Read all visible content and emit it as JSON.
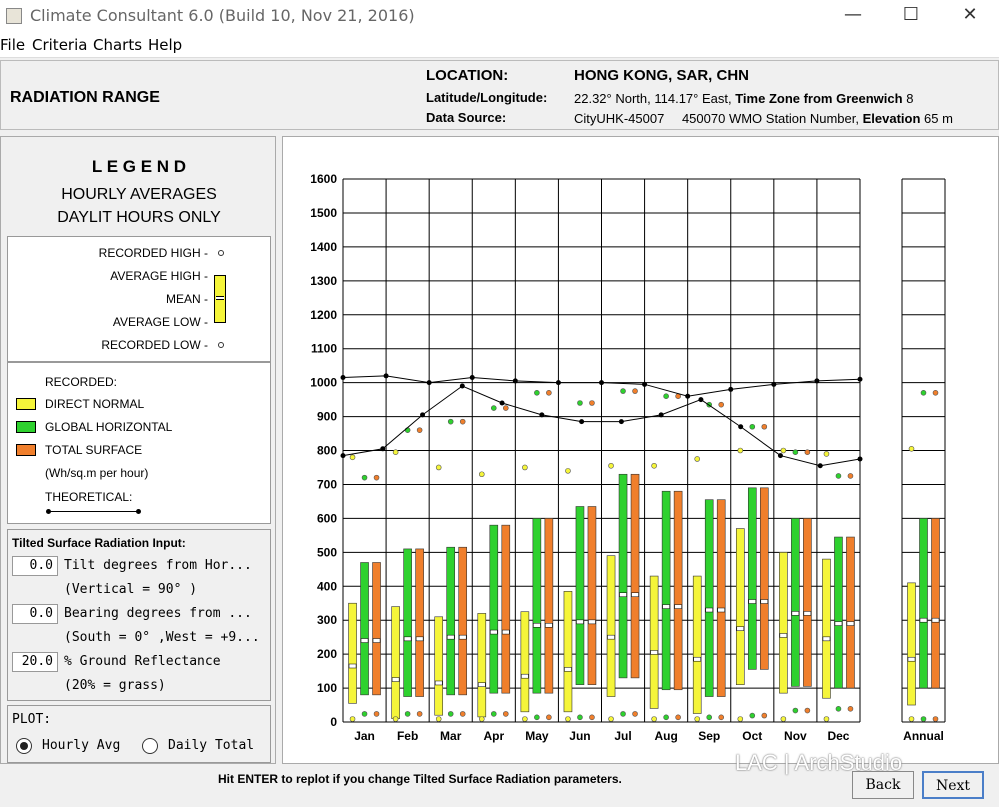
{
  "window": {
    "title": "Climate Consultant 6.0 (Build 10, Nov 21, 2016)",
    "minimize": "—",
    "maximize": "☐",
    "close": "✕"
  },
  "menu": [
    "File",
    "Criteria",
    "Charts",
    "Help"
  ],
  "header": {
    "page_title": "RADIATION RANGE",
    "location_label": "LOCATION:",
    "location_value": "HONG KONG, SAR, CHN",
    "latlon_label": "Latitude/Longitude:",
    "latlon_value": "22.32° North, 114.17° East,",
    "tz_label": "Time Zone from Greenwich",
    "tz_value": "8",
    "source_label": "Data Source:",
    "source_value": "CityUHK-45007",
    "wmo_value": "450070 WMO Station Number,",
    "elev_label": "Elevation",
    "elev_value": "65 m"
  },
  "legend": {
    "title": "L E G E N D",
    "subtitle1": "HOURLY AVERAGES",
    "subtitle2": "DAYLIT HOURS ONLY",
    "recorded_high": "RECORDED HIGH -",
    "average_high": "AVERAGE HIGH -",
    "mean": "MEAN -",
    "average_low": "AVERAGE LOW -",
    "recorded_low": "RECORDED LOW -",
    "recorded": "RECORDED:",
    "direct_normal": "DIRECT NORMAL",
    "global_horizontal": "GLOBAL HORIZONTAL",
    "total_surface": "TOTAL SURFACE",
    "units": "(Wh/sq.m per hour)",
    "theoretical": "THEORETICAL:"
  },
  "tilted": {
    "title": "Tilted Surface Radiation Input:",
    "tilt_value": "0.0",
    "tilt_label": "Tilt degrees from Hor...",
    "tilt_note": "(Vertical = 90° )",
    "bearing_value": "0.0",
    "bearing_label": "Bearing degrees from ...",
    "bearing_note": "(South = 0° ,West = +9...",
    "ground_value": "20.0",
    "ground_label": "% Ground Reflectance",
    "ground_note": "(20% = grass)"
  },
  "plot": {
    "title": "PLOT:",
    "hourly": "Hourly Avg",
    "daily": "Daily Total",
    "selected": "hourly"
  },
  "footer": {
    "message": "Hit ENTER to replot if you change Tilted Surface Radiation parameters.",
    "back": "Back",
    "next": "Next"
  },
  "watermark": "LAC | ArchStudio",
  "colors": {
    "direct_normal": "#f5f53a",
    "global_horizontal": "#2ed12e",
    "total_surface": "#f07f2c",
    "mean": "#ffffff"
  },
  "chart_data": {
    "type": "bar",
    "ylim": [
      0,
      1600
    ],
    "yticks": [
      0,
      100,
      200,
      300,
      400,
      500,
      600,
      700,
      800,
      900,
      1000,
      1100,
      1200,
      1300,
      1400,
      1500,
      1600
    ],
    "categories": [
      "Jan",
      "Feb",
      "Mar",
      "Apr",
      "May",
      "Jun",
      "Jul",
      "Aug",
      "Sep",
      "Oct",
      "Nov",
      "Dec"
    ],
    "annual_label": "Annual",
    "series": [
      {
        "name": "DIRECT NORMAL",
        "avg_low": [
          55,
          10,
          20,
          15,
          30,
          30,
          75,
          40,
          25,
          110,
          85,
          70
        ],
        "avg_high": [
          350,
          340,
          310,
          320,
          325,
          385,
          490,
          430,
          430,
          570,
          500,
          480
        ],
        "mean": [
          165,
          125,
          115,
          110,
          135,
          155,
          250,
          205,
          185,
          275,
          255,
          245
        ],
        "rec_high": [
          780,
          795,
          750,
          730,
          750,
          740,
          755,
          755,
          775,
          800,
          800,
          790
        ],
        "rec_low": [
          0,
          0,
          0,
          0,
          0,
          0,
          0,
          0,
          0,
          0,
          0,
          0
        ]
      },
      {
        "name": "GLOBAL HORIZONTAL",
        "avg_low": [
          80,
          75,
          80,
          85,
          85,
          110,
          130,
          95,
          75,
          155,
          105,
          100
        ],
        "avg_high": [
          470,
          510,
          515,
          580,
          600,
          635,
          730,
          680,
          655,
          690,
          600,
          545
        ],
        "mean": [
          240,
          245,
          250,
          265,
          285,
          295,
          375,
          340,
          330,
          355,
          320,
          290
        ],
        "rec_high": [
          720,
          860,
          885,
          925,
          970,
          940,
          975,
          960,
          935,
          870,
          795,
          725
        ],
        "rec_low": [
          15,
          15,
          15,
          15,
          5,
          5,
          15,
          5,
          5,
          10,
          25,
          30
        ]
      },
      {
        "name": "TOTAL SURFACE",
        "avg_low": [
          80,
          75,
          80,
          85,
          85,
          110,
          130,
          95,
          75,
          155,
          105,
          100
        ],
        "avg_high": [
          470,
          510,
          515,
          580,
          600,
          635,
          730,
          680,
          655,
          690,
          600,
          545
        ],
        "mean": [
          240,
          245,
          250,
          265,
          285,
          295,
          375,
          340,
          330,
          355,
          320,
          290
        ],
        "rec_high": [
          720,
          860,
          885,
          925,
          970,
          940,
          975,
          960,
          935,
          870,
          795,
          725
        ],
        "rec_low": [
          15,
          15,
          15,
          15,
          5,
          5,
          15,
          5,
          5,
          10,
          25,
          30
        ]
      }
    ],
    "annual": [
      {
        "name": "DIRECT NORMAL",
        "avg_low": 50,
        "avg_high": 410,
        "mean": 185,
        "rec_high": 805,
        "rec_low": 0
      },
      {
        "name": "GLOBAL HORIZONTAL",
        "avg_low": 100,
        "avg_high": 600,
        "mean": 300,
        "rec_high": 970,
        "rec_low": 0
      },
      {
        "name": "TOTAL SURFACE",
        "avg_low": 100,
        "avg_high": 600,
        "mean": 300,
        "rec_high": 970,
        "rec_low": 0
      }
    ],
    "theoretical_direct_normal": [
      1015,
      1020,
      1000,
      1015,
      1005,
      1000,
      1000,
      995,
      960,
      980,
      995,
      1005,
      1010
    ],
    "theoretical_global_horizontal": [
      785,
      805,
      905,
      990,
      940,
      905,
      885,
      885,
      905,
      950,
      870,
      785,
      755,
      775
    ]
  }
}
